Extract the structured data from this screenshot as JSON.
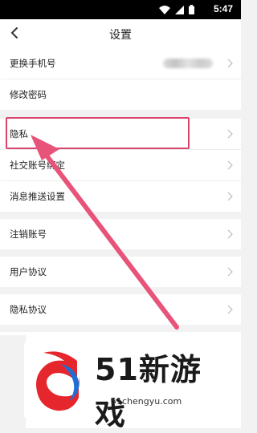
{
  "status_bar": {
    "time": "5:47",
    "icons": [
      "wifi-icon",
      "signal-icon",
      "battery-icon"
    ]
  },
  "header": {
    "title": "设置",
    "back_icon": "chevron-left-icon"
  },
  "settings": {
    "change_phone": {
      "label": "更换手机号"
    },
    "change_password": {
      "label": "修改密码"
    },
    "privacy": {
      "label": "隐私"
    },
    "social_binding": {
      "label": "社交账号绑定"
    },
    "push_settings": {
      "label": "消息推送设置"
    },
    "cancel_account": {
      "label": "注销账号"
    },
    "user_agreement": {
      "label": "用户协议"
    },
    "privacy_policy": {
      "label": "隐私协议"
    }
  },
  "annotation": {
    "highlight_color": "#d9446d",
    "arrow_color": "#e8537a"
  },
  "watermark": {
    "brand": "51新游戏",
    "url": "51chengyu.com"
  }
}
